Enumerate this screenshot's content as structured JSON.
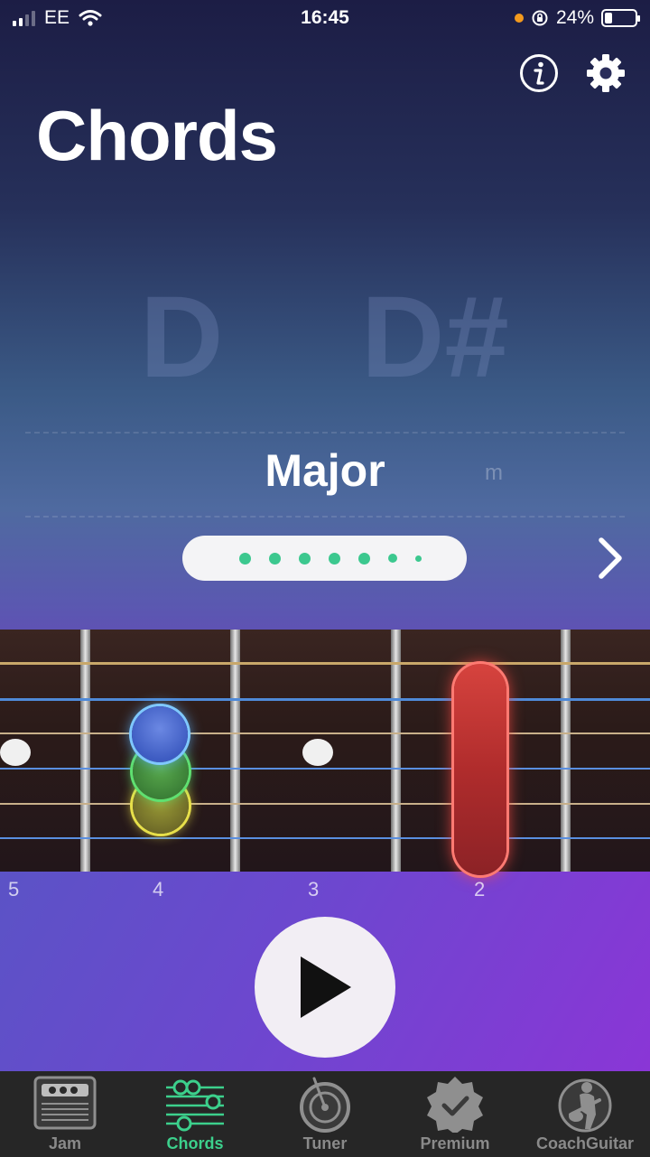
{
  "status_bar": {
    "carrier": "EE",
    "time": "16:45",
    "battery_percent": "24%",
    "battery_level": 0.24
  },
  "header": {
    "title": "Chords",
    "info_icon": "info-icon",
    "settings_icon": "gear-icon"
  },
  "chord_picker": {
    "root_notes": [
      "D",
      "D#"
    ],
    "quality_selected": "Major",
    "quality_next": "m",
    "pager_dot_count": 7,
    "next_icon": "chevron-right-icon"
  },
  "fretboard": {
    "fret_numbers": [
      "5",
      "4",
      "3",
      "2"
    ]
  },
  "player": {
    "play_icon": "play-icon"
  },
  "tabbar": {
    "tabs": [
      {
        "label": "Jam",
        "icon": "amp-icon",
        "active": false
      },
      {
        "label": "Chords",
        "icon": "chords-icon",
        "active": true
      },
      {
        "label": "Tuner",
        "icon": "tuner-icon",
        "active": false
      },
      {
        "label": "Premium",
        "icon": "premium-badge-icon",
        "active": false
      },
      {
        "label": "CoachGuitar",
        "icon": "coach-guitar-icon",
        "active": false
      }
    ]
  },
  "colors": {
    "accent_green": "#3cd08c",
    "barre_red": "#d6433e",
    "finger_blue": "#3e5cc2",
    "finger_green": "#3b7f37",
    "finger_yellow": "#9a9a36"
  }
}
